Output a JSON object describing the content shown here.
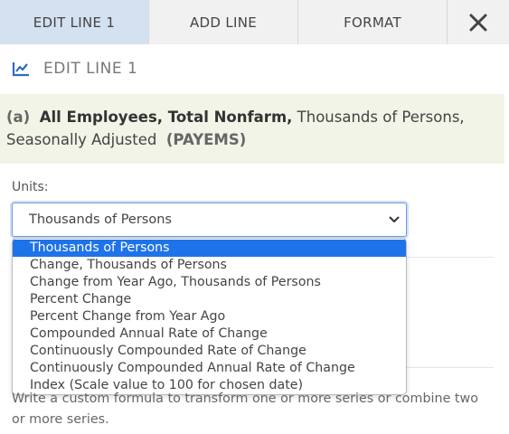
{
  "tabs": [
    {
      "label": "EDIT LINE 1",
      "active": true
    },
    {
      "label": "ADD LINE",
      "active": false
    },
    {
      "label": "FORMAT",
      "active": false
    }
  ],
  "close_icon": "close-x-icon",
  "section": {
    "icon": "line-chart-icon",
    "title": "EDIT LINE 1"
  },
  "series": {
    "tag": "(a)",
    "name": "All Employees, Total Nonfarm,",
    "desc": "Thousands of Persons, Seasonally Adjusted",
    "code": "(PAYEMS)"
  },
  "units": {
    "label": "Units:",
    "selected": "Thousands of Persons",
    "options": [
      "Thousands of Persons",
      "Change, Thousands of Persons",
      "Change from Year Ago, Thousands of Persons",
      "Percent Change",
      "Percent Change from Year Ago",
      "Compounded Annual Rate of Change",
      "Continuously Compounded Rate of Change",
      "Continuously Compounded Annual Rate of Change",
      "Index (Scale value to 100 for chosen date)"
    ],
    "highlighted_index": 0
  },
  "help_text": "Write a custom formula to transform one or more series or combine two or more series.",
  "colors": {
    "active_tab": "#d4e1f1",
    "series_bg": "#f1f4e6",
    "highlight": "#1e73e8"
  }
}
